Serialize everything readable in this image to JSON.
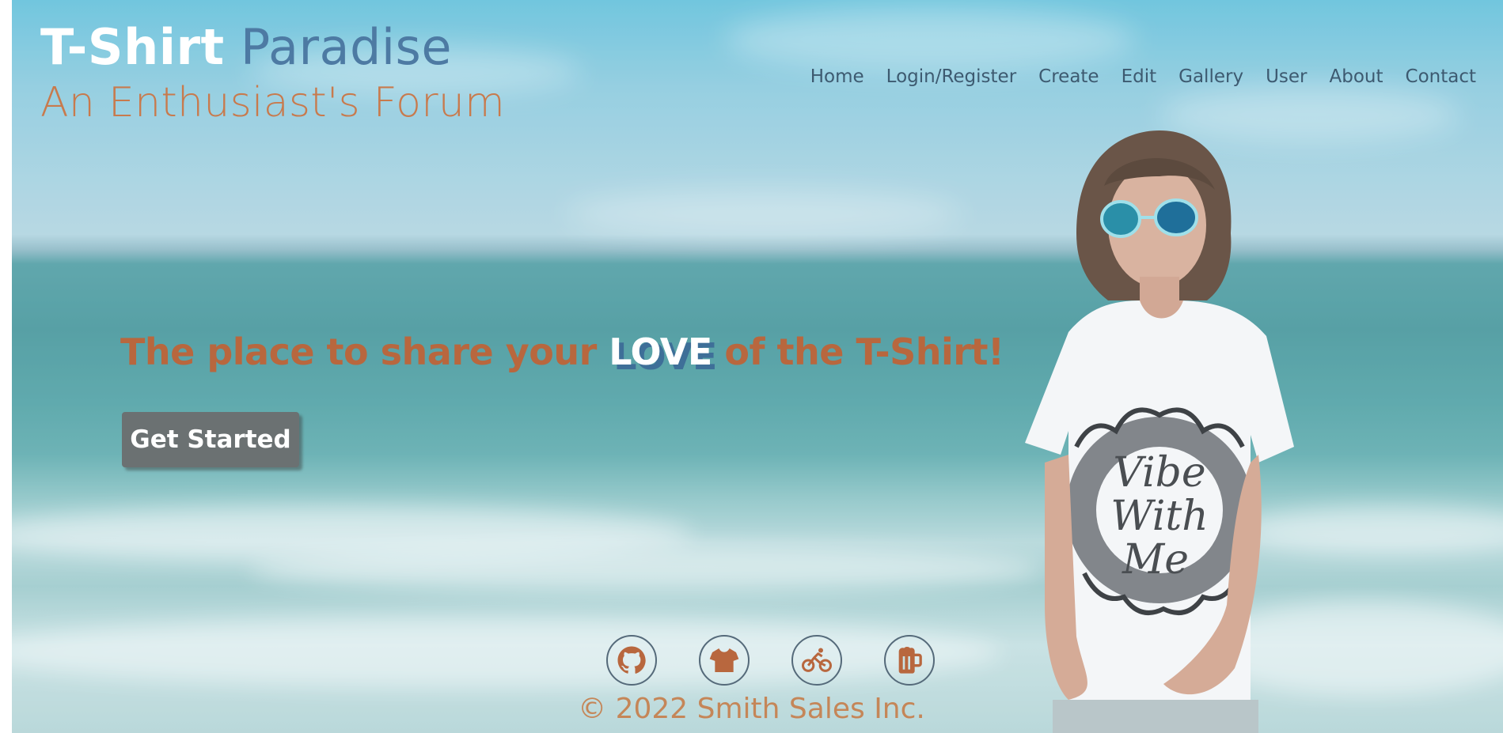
{
  "brand": {
    "title_part1": "T-Shirt",
    "title_part2": "Paradise",
    "tagline": "An Enthusiast's Forum"
  },
  "nav": {
    "items": [
      "Home",
      "Login/Register",
      "Create",
      "Edit",
      "Gallery",
      "User",
      "About",
      "Contact"
    ]
  },
  "hero": {
    "headline_before": "The place to share your ",
    "headline_love": "LOVE",
    "headline_after": " of the T-Shirt!",
    "cta_label": "Get Started",
    "shirt_print": [
      "Vibe",
      "With",
      "Me"
    ]
  },
  "social": {
    "icons": [
      "github-icon",
      "tshirt-icon",
      "bicycle-icon",
      "beer-mug-icon"
    ]
  },
  "footer": {
    "copyright": "© 2022 Smith Sales Inc."
  },
  "colors": {
    "brand_white": "#ffffff",
    "brand_blue": "#4d7aa3",
    "accent_orange": "#b8673e",
    "nav_text": "#3d5a70",
    "button_bg": "#6b7172"
  }
}
